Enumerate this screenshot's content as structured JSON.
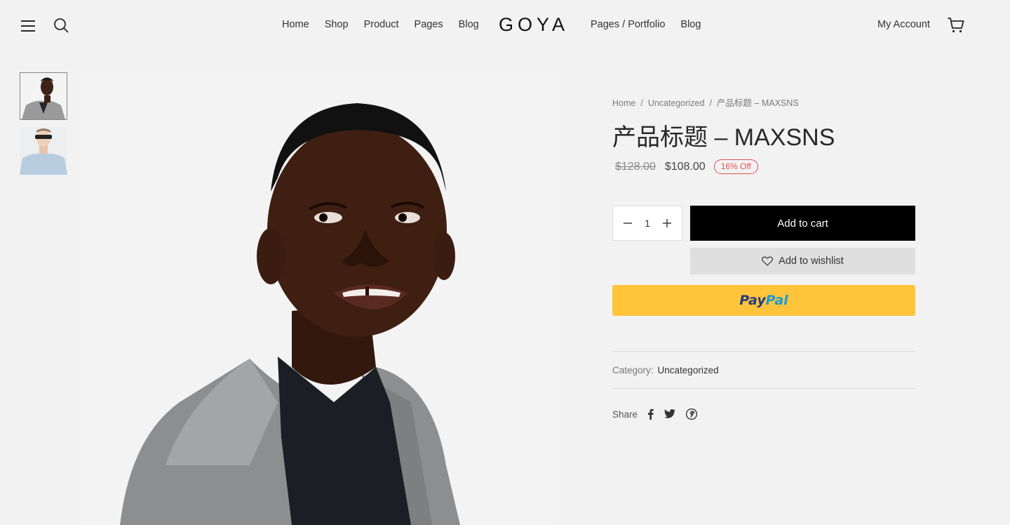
{
  "header": {
    "logo": "GOYA",
    "nav_left": [
      "Home",
      "Shop",
      "Product",
      "Pages",
      "Blog"
    ],
    "nav_right": [
      "Pages / Portfolio",
      "Blog"
    ],
    "account": "My Account"
  },
  "breadcrumb": {
    "home": "Home",
    "category": "Uncategorized",
    "current": "产品标题 – MAXSNS"
  },
  "product": {
    "title": "产品标题 – MAXSNS",
    "old_price": "$128.00",
    "new_price": "$108.00",
    "discount_badge": "16% Off",
    "quantity": "1",
    "add_to_cart": "Add to cart",
    "add_to_wishlist": "Add to wishlist",
    "paypal_pay": "Pay",
    "paypal_pal": "Pal",
    "category_label": "Category:",
    "category_value": "Uncategorized",
    "share_label": "Share"
  },
  "colors": {
    "accent": "#000000",
    "badge": "#e05353",
    "paypal_bg": "#ffc439"
  },
  "icons": [
    "menu-icon",
    "search-icon",
    "cart-icon",
    "heart-icon",
    "minus-icon",
    "plus-icon",
    "facebook-icon",
    "twitter-icon",
    "pinterest-icon"
  ]
}
